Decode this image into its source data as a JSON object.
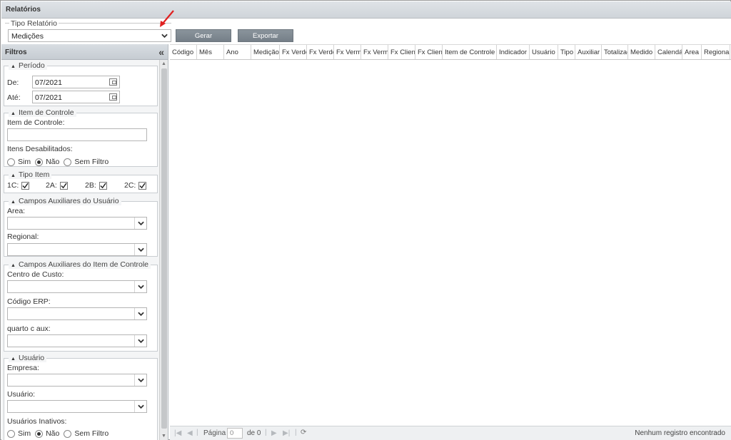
{
  "window": {
    "title": "Relatórios"
  },
  "toolbar": {
    "tipo_relatorio_label": "Tipo Relatório",
    "tipo_relatorio_value": "Medições",
    "gerar_label": "Gerar",
    "exportar_label": "Exportar"
  },
  "filters": {
    "header": "Filtros",
    "periodo": {
      "title": "Período",
      "de_label": "De:",
      "de_value": "07/2021",
      "ate_label": "Até:",
      "ate_value": "07/2021"
    },
    "item_controle": {
      "title": "Item de Controle",
      "field_label": "Item de Controle:",
      "field_value": "",
      "desabilitados_label": "Itens Desabilitados:",
      "options": [
        "Sim",
        "Não",
        "Sem Filtro"
      ],
      "selected": "Não"
    },
    "tipo_item": {
      "title": "Tipo Item",
      "items": [
        {
          "label": "1C:",
          "checked": true
        },
        {
          "label": "2A:",
          "checked": true
        },
        {
          "label": "2B:",
          "checked": true
        },
        {
          "label": "2C:",
          "checked": true
        }
      ]
    },
    "campos_usuario": {
      "title": "Campos Auxiliares do Usuário",
      "area_label": "Area:",
      "regional_label": "Regional:"
    },
    "campos_item": {
      "title": "Campos Auxiliares do Item de Controle",
      "centro_custo_label": "Centro de Custo:",
      "codigo_erp_label": "Código ERP:",
      "quarto_label": "quarto c aux:"
    },
    "usuario": {
      "title": "Usuário",
      "empresa_label": "Empresa:",
      "usuario_label": "Usuário:",
      "inativos_label": "Usuários Inativos:",
      "options": [
        "Sim",
        "Não",
        "Sem Filtro"
      ],
      "selected": "Não"
    }
  },
  "grid": {
    "columns": [
      "Código",
      "Mês",
      "Ano",
      "Medição",
      "Fx Verde",
      "Fx Verde",
      "Fx Verme",
      "Fx Verme",
      "Fx Client",
      "Fx Client",
      "Item de Controle",
      "Indicador",
      "Usuário",
      "Tipo",
      "Auxiliar",
      "Totalizac",
      "Medido",
      "Calendár",
      "Area",
      "Regional"
    ],
    "pager": {
      "page_label": "Página",
      "page_value": "0",
      "of_label": "de 0",
      "empty_message": "Nenhum registro encontrado"
    }
  }
}
